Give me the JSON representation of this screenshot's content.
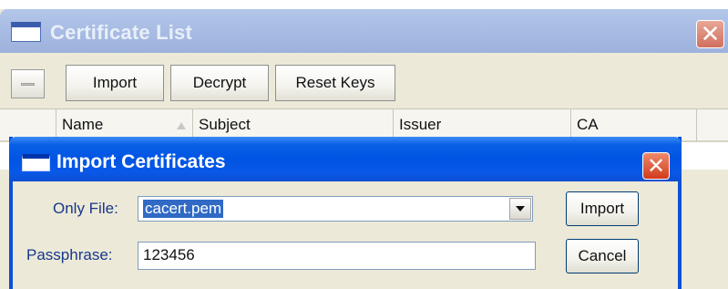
{
  "certificate_list": {
    "title": "Certificate List",
    "toolbar": {
      "import_label": "Import",
      "decrypt_label": "Decrypt",
      "reset_keys_label": "Reset Keys"
    },
    "columns": [
      "Name",
      "Subject",
      "Issuer",
      "CA"
    ],
    "sort_column": "Name",
    "sort_direction": "ascending"
  },
  "import_dialog": {
    "title": "Import Certificates",
    "only_file_label": "Only File:",
    "only_file_value": "cacert.pem",
    "passphrase_label": "Passphrase:",
    "passphrase_value": "123456",
    "import_button": "Import",
    "cancel_button": "Cancel"
  },
  "icons": {
    "window": "window-icon",
    "close": "close-icon",
    "dropdown": "chevron-down-icon",
    "sort": "sort-asc-icon",
    "toggle": "minus-icon"
  },
  "colors": {
    "active_title": "#0054e3",
    "inactive_title": "#a9bde4",
    "close_active": "#d23b1c",
    "selection": "#316ac5",
    "label_text": "#17388a",
    "window_bg": "#ece9d8"
  }
}
